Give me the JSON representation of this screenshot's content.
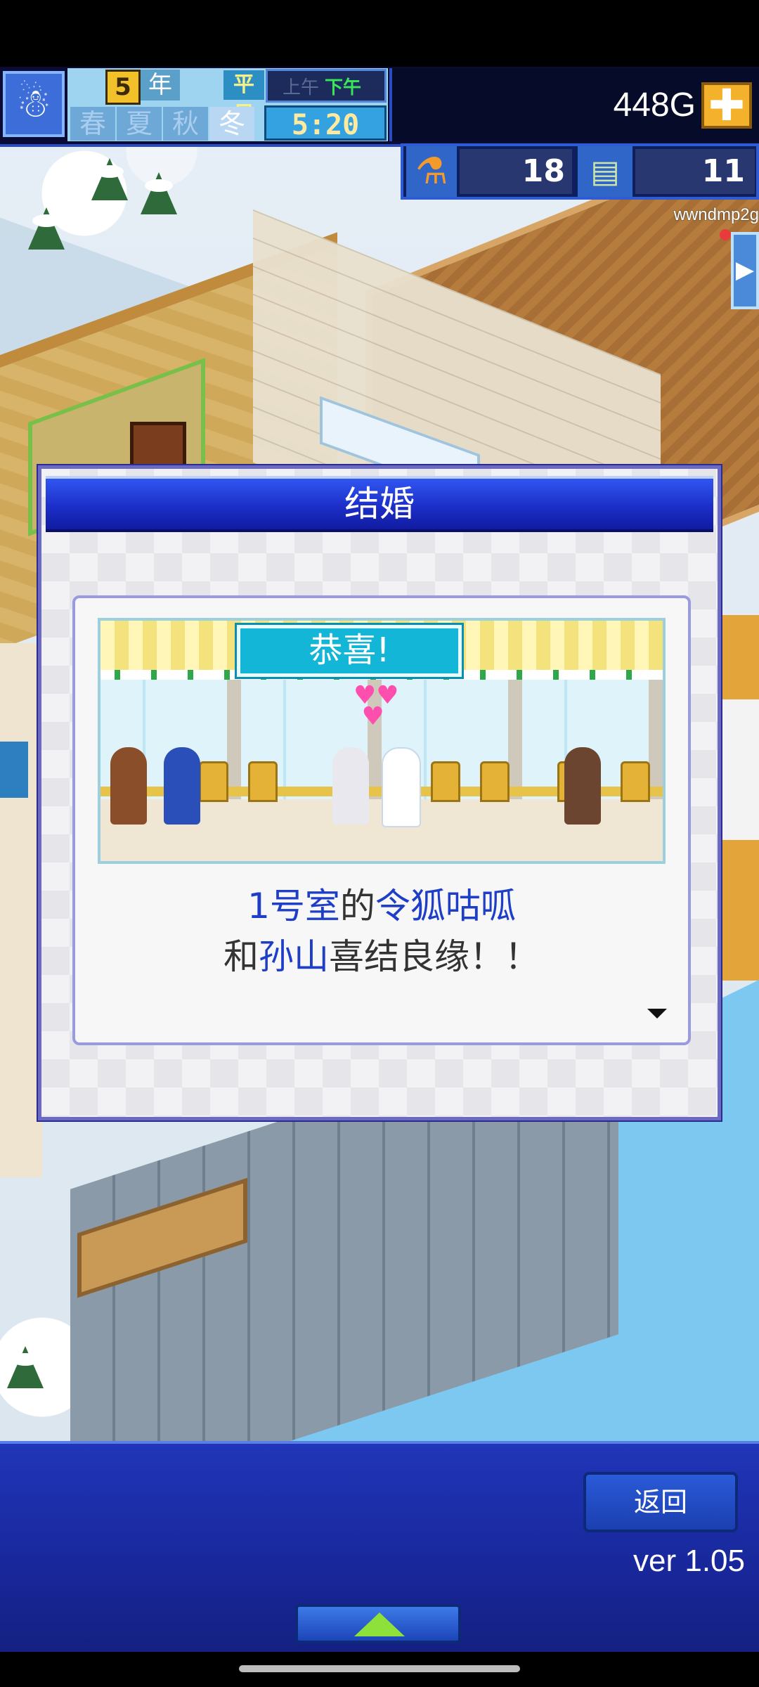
{
  "hud": {
    "year_number": "5",
    "year_label": "年",
    "day_kind": "平日",
    "am_label": "上午",
    "pm_label": "下午",
    "seasons": [
      "春",
      "夏",
      "秋",
      "冬"
    ],
    "active_season": "冬",
    "clock": "5:20",
    "money": "448G",
    "plus_symbol": "✚",
    "research_points": "18",
    "tickets": "11",
    "player_id": "wwndmp2g"
  },
  "dialog": {
    "title": "结婚",
    "congrats": "恭喜!",
    "room": "1号室",
    "connector1": "的",
    "resident": "令狐咕呱",
    "connector2": "和",
    "partner": "孙山",
    "ending": "喜结良缘！！"
  },
  "footer": {
    "back_label": "返回",
    "version": "ver 1.05"
  },
  "colors": {
    "dialog_title_blue": "#1c2fc8",
    "name_blue": "#1e3ec8",
    "congrats_cyan": "#14b6d8",
    "footer_blue": "#18279a",
    "money_button_orange": "#f4b12c"
  },
  "icons": [
    "snowman-avatar-icon",
    "plus-icon",
    "flask-icon",
    "ticket-icon",
    "right-arrow-icon",
    "down-arrow-icon",
    "up-arrow-icon"
  ]
}
